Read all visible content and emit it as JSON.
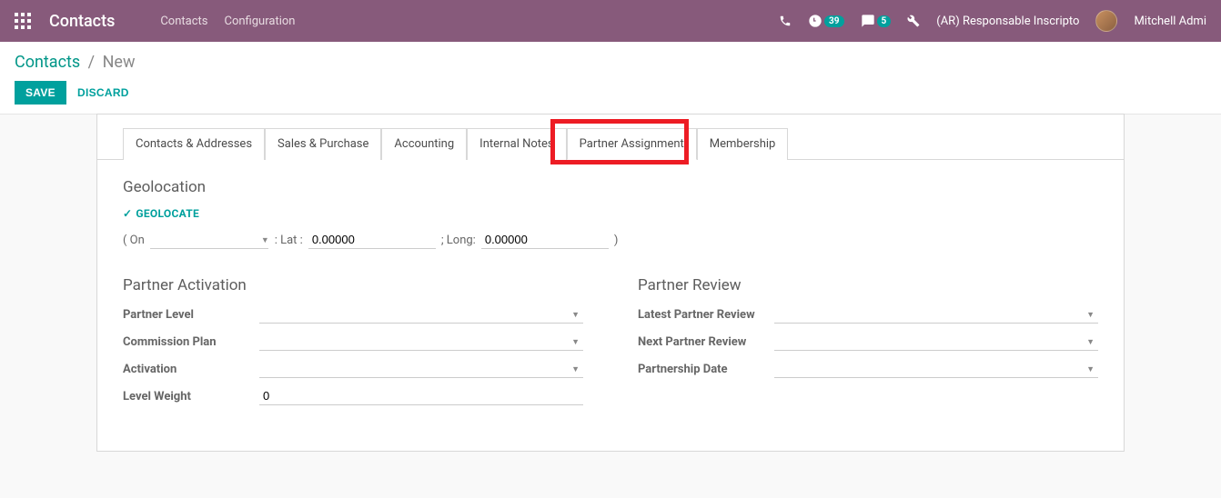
{
  "topbar": {
    "app_title": "Contacts",
    "menu": {
      "contacts": "Contacts",
      "configuration": "Configuration"
    },
    "badges": {
      "activities": "39",
      "messages": "5"
    },
    "responsability": "(AR) Responsable Inscripto",
    "user_name": "Mitchell Admi"
  },
  "breadcrumb": {
    "root": "Contacts",
    "current": "New"
  },
  "actions": {
    "save": "SAVE",
    "discard": "DISCARD"
  },
  "tabs": {
    "contacts_addresses": "Contacts & Addresses",
    "sales_purchase": "Sales & Purchase",
    "accounting": "Accounting",
    "internal_notes": "Internal Notes",
    "partner_assignment": "Partner Assignment",
    "membership": "Membership"
  },
  "geolocation": {
    "title": "Geolocation",
    "geolocate_btn": "GEOLOCATE",
    "on_prefix": "( On",
    "on_date": "",
    "lat_label": ": Lat :",
    "lat_value": "0.00000",
    "long_label": "; Long:",
    "long_value": "0.00000",
    "suffix": ")"
  },
  "partner_activation": {
    "title": "Partner Activation",
    "fields": {
      "partner_level": {
        "label": "Partner Level",
        "value": ""
      },
      "commission_plan": {
        "label": "Commission Plan",
        "value": ""
      },
      "activation": {
        "label": "Activation",
        "value": ""
      },
      "level_weight": {
        "label": "Level Weight",
        "value": "0"
      }
    }
  },
  "partner_review": {
    "title": "Partner Review",
    "fields": {
      "latest_review": {
        "label": "Latest Partner Review",
        "value": ""
      },
      "next_review": {
        "label": "Next Partner Review",
        "value": ""
      },
      "partnership_date": {
        "label": "Partnership Date",
        "value": ""
      }
    }
  }
}
